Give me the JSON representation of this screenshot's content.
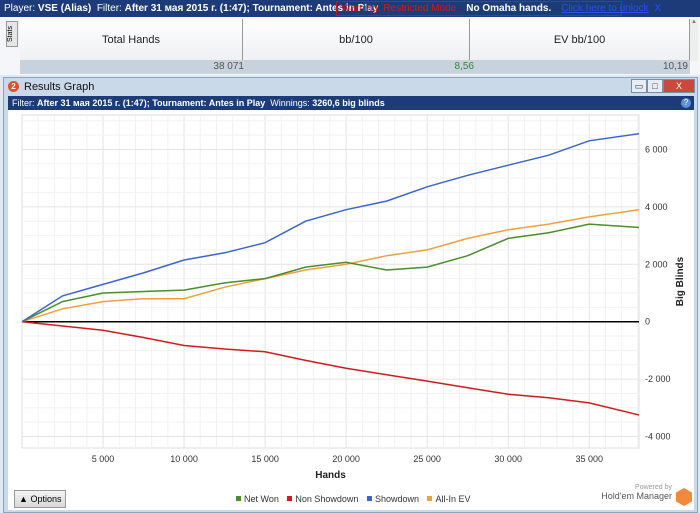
{
  "topbar": {
    "player_label": "Player:",
    "player": "VSE (Alias)",
    "filter_label": "Filter:",
    "filter": "After 31 мая 2015 г. (1:47); Tournament: Antes in Play",
    "warning": "Warning: Restricted Mode",
    "no_omaha": "No Omaha hands.",
    "unlock": "Click here to unlock",
    "close": "X"
  },
  "stats": {
    "tab": "Stats",
    "headers": [
      "Total Hands",
      "bb/100",
      "EV bb/100"
    ],
    "values": [
      "38 071",
      "8,56",
      "10,19"
    ],
    "value_colors": [
      "#555555",
      "#2e8b2e",
      "#555555"
    ]
  },
  "window": {
    "title": "Results Graph",
    "filter_label": "Filter:",
    "filter": "After 31 мая 2015 г. (1:47); Tournament: Antes in Play",
    "winnings_label": "Winnings:",
    "winnings": "3260,6 big blinds"
  },
  "bottom": {
    "options": "Options",
    "powered_by": "Powered by",
    "brand": "Hold'em Manager",
    "brand_logo": "2"
  },
  "chart_data": {
    "type": "line",
    "xlabel": "Hands",
    "ylabel": "Big Blinds",
    "xlim": [
      0,
      38071
    ],
    "ylim": [
      -4400,
      7200
    ],
    "xticks": [
      5000,
      10000,
      15000,
      20000,
      25000,
      30000,
      35000
    ],
    "xtick_labels": [
      "5 000",
      "10 000",
      "15 000",
      "20 000",
      "25 000",
      "30 000",
      "35 000"
    ],
    "yticks": [
      -4000,
      -2000,
      0,
      2000,
      4000,
      6000
    ],
    "ytick_labels": [
      "-4 000",
      "-2 000",
      "0",
      "2 000",
      "4 000",
      "6 000"
    ],
    "grid": true,
    "legend": "bottom",
    "x": [
      0,
      2500,
      5000,
      7500,
      10000,
      12500,
      15000,
      17500,
      20000,
      22500,
      25000,
      27500,
      30000,
      32500,
      35000,
      38071
    ],
    "series": [
      {
        "name": "Net Won",
        "color": "#4a8f2a",
        "values": [
          0,
          700,
          1000,
          1050,
          1100,
          1350,
          1500,
          1900,
          2070,
          1800,
          1900,
          2300,
          2900,
          3100,
          3400,
          3280
        ]
      },
      {
        "name": "Non Showdown",
        "color": "#d01c1c",
        "values": [
          0,
          -150,
          -300,
          -550,
          -830,
          -950,
          -1050,
          -1350,
          -1620,
          -1850,
          -2070,
          -2300,
          -2530,
          -2650,
          -2830,
          -3250
        ]
      },
      {
        "name": "Showdown",
        "color": "#3a66cc",
        "values": [
          0,
          900,
          1300,
          1700,
          2150,
          2400,
          2750,
          3500,
          3900,
          4200,
          4700,
          5100,
          5450,
          5800,
          6300,
          6550
        ]
      },
      {
        "name": "All-In EV",
        "color": "#f0a040",
        "values": [
          0,
          450,
          700,
          800,
          800,
          1200,
          1500,
          1800,
          2000,
          2300,
          2500,
          2900,
          3200,
          3400,
          3650,
          3900
        ]
      }
    ]
  }
}
